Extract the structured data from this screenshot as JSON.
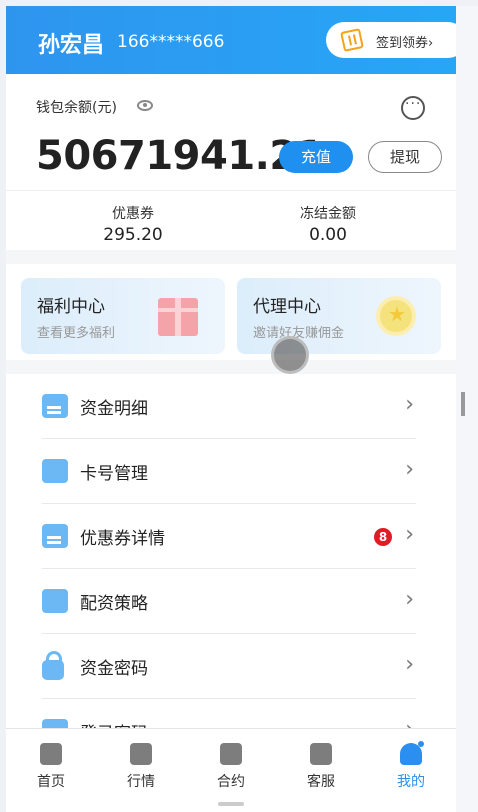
{
  "user": {
    "name": "孙宏昌",
    "phone": "166*****666"
  },
  "header": {
    "checkin_label": "签到领券",
    "checkin_chevron": "›"
  },
  "wallet": {
    "balance_label": "钱包余额(元)",
    "balance": "50671941.21",
    "recharge_label": "充值",
    "withdraw_label": "提现"
  },
  "stats": [
    {
      "label": "优惠券",
      "value": "295.20"
    },
    {
      "label": "冻结金额",
      "value": "0.00"
    }
  ],
  "cards": [
    {
      "title": "福利中心",
      "subtitle": "查看更多福利",
      "icon": "gift-icon"
    },
    {
      "title": "代理中心",
      "subtitle": "邀请好友赚佣金",
      "icon": "coin-icon"
    }
  ],
  "menu": [
    {
      "label": "资金明细",
      "icon": "document-icon"
    },
    {
      "label": "卡号管理",
      "icon": "folder-icon"
    },
    {
      "label": "优惠券详情",
      "icon": "ticket-icon",
      "badge": "8"
    },
    {
      "label": "配资策略",
      "icon": "book-icon"
    },
    {
      "label": "资金密码",
      "icon": "lock-icon"
    },
    {
      "label": "登录密码",
      "icon": "key-icon"
    }
  ],
  "menu_chevron": "›",
  "tabs": [
    {
      "label": "首页",
      "icon": "home-icon"
    },
    {
      "label": "行情",
      "icon": "chart-icon"
    },
    {
      "label": "合约",
      "icon": "contract-icon"
    },
    {
      "label": "客服",
      "icon": "headset-icon"
    },
    {
      "label": "我的",
      "icon": "user-icon",
      "active": true
    }
  ],
  "colors": {
    "primary": "#1f8ff0",
    "badge": "#e01b25"
  }
}
